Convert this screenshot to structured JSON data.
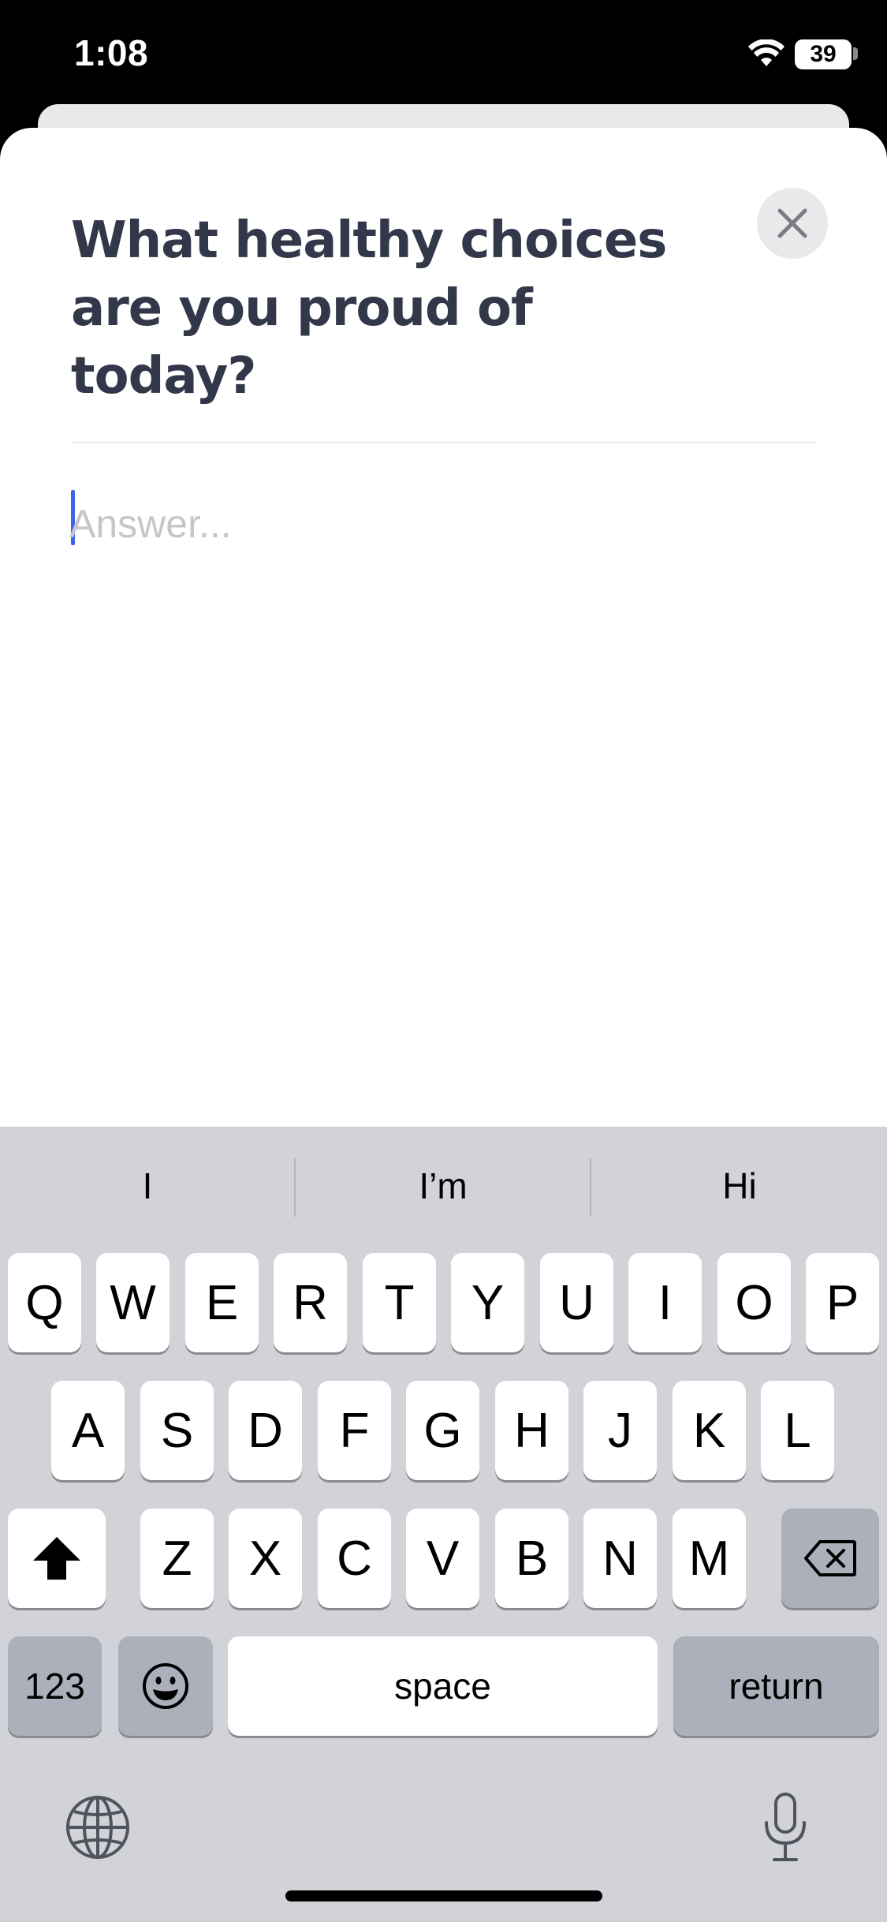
{
  "status_bar": {
    "time": "1:08",
    "battery": "39",
    "icons": [
      "wifi-icon",
      "battery-icon"
    ]
  },
  "prompt": {
    "title": "What healthy choices are you proud of today?",
    "answer_placeholder": "Answer...",
    "answer_value": "",
    "close_icon": "close-icon"
  },
  "keyboard": {
    "suggestions": [
      "I",
      "I’m",
      "Hi"
    ],
    "row1": [
      "Q",
      "W",
      "E",
      "R",
      "T",
      "Y",
      "U",
      "I",
      "O",
      "P"
    ],
    "row2": [
      "A",
      "S",
      "D",
      "F",
      "G",
      "H",
      "J",
      "K",
      "L"
    ],
    "row3": [
      "Z",
      "X",
      "C",
      "V",
      "B",
      "N",
      "M"
    ],
    "numbers_label": "123",
    "space_label": "space",
    "return_label": "return",
    "icons": [
      "shift-icon",
      "backspace-icon",
      "emoji-icon",
      "globe-icon",
      "microphone-icon"
    ]
  },
  "colors": {
    "title": "#33374a",
    "caret": "#3e64ea",
    "keyboard_bg": "#d1d3d9",
    "key": "#ffffff",
    "key_dark": "#acb0bb"
  }
}
